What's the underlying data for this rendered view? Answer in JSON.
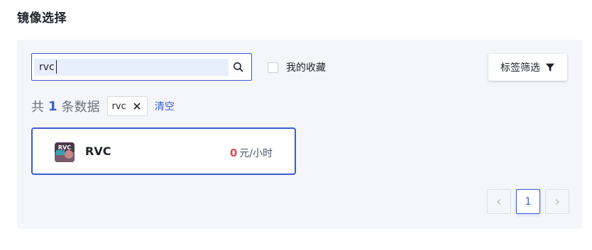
{
  "page": {
    "title": "镜像选择"
  },
  "search": {
    "value": "rvc",
    "icon": "search-icon"
  },
  "favorites": {
    "label": "我的收藏",
    "checked": false
  },
  "tag_filter": {
    "label": "标签筛选",
    "icon": "filter-icon"
  },
  "summary": {
    "prefix": "共",
    "count": "1",
    "suffix": "条数据",
    "active_tag": "rvc",
    "clear_label": "清空"
  },
  "results": [
    {
      "name": "RVC",
      "price_value": "0",
      "price_unit": "元/小时",
      "logo_text": "RVC",
      "selected": true
    }
  ],
  "pagination": {
    "current_page": "1",
    "prev_disabled": true,
    "next_disabled": true
  },
  "colors": {
    "accent": "#3a5ccc",
    "price": "#e5484d",
    "panel_bg": "#f5f6fa"
  }
}
